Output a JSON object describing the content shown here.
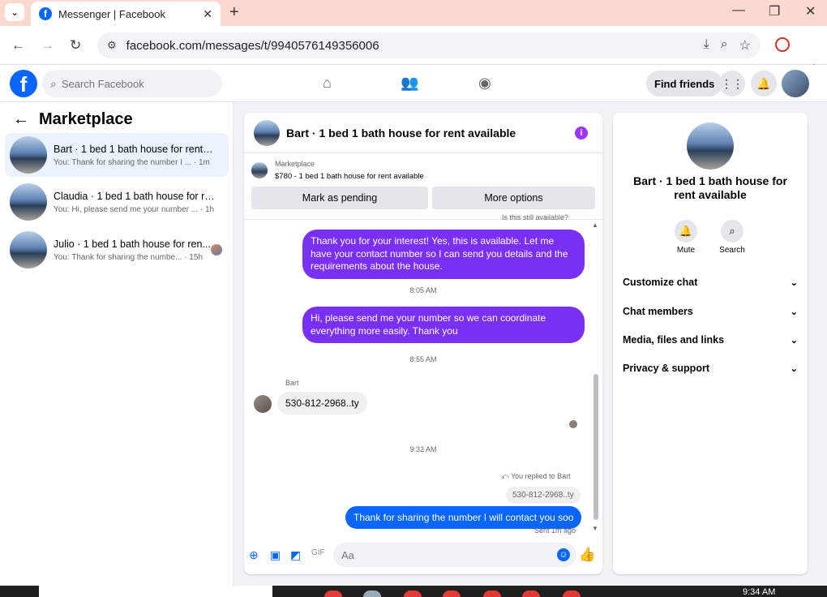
{
  "browser": {
    "tab_title": "Messenger | Facebook",
    "url": "facebook.com/messages/t/9940576149356006"
  },
  "fb": {
    "search_placeholder": "Search Facebook",
    "find_friends": "Find friends"
  },
  "left": {
    "title": "Marketplace",
    "conversations": [
      {
        "name": "Bart · 1 bed 1 bath house for rent a...",
        "preview": "You: Thank for sharing the number I ...",
        "time": "· 1m"
      },
      {
        "name": "Claudia · 1 bed 1 bath house for re...",
        "preview": "You: Hi, please send me your number ...",
        "time": "· 1h"
      },
      {
        "name": "Julio · 1 bed 1 bath house for ren...",
        "preview": "You: Thank for sharing the numbe...",
        "time": "· 15h"
      }
    ]
  },
  "chat": {
    "title": "Bart · 1 bed 1 bath house for rent available",
    "mp_label": "Marketplace",
    "mp_price": "$780 - 1 bed 1 bath house for rent available",
    "mark_pending": "Mark as pending",
    "more_options": "More options",
    "faded_top": "Is this still available?",
    "msg1": "Thank you for your interest! Yes, this is available. Let me have your contact number so I can send you details and the requirements about the house.",
    "time1": "8:05 AM",
    "msg2": "Hi, please send me your number so we can coordinate everything more easily. Thank you",
    "time2": "8:55 AM",
    "sender": "Bart",
    "msg3": "530-812-2968..ty",
    "time3": "9:32 AM",
    "replied": "You replied to Bart",
    "quote": "530-812-2968..ty",
    "msg4": "Thank for sharing  the number I will contact you soo",
    "sent": "Sent 1m ago",
    "composer_placeholder": "Aa"
  },
  "info": {
    "name": "Bart · 1 bed 1 bath house for rent available",
    "mute": "Mute",
    "search": "Search",
    "sections": [
      "Customize chat",
      "Chat members",
      "Media, files and links",
      "Privacy & support"
    ]
  },
  "taskbar": {
    "time": "9:34 AM"
  }
}
